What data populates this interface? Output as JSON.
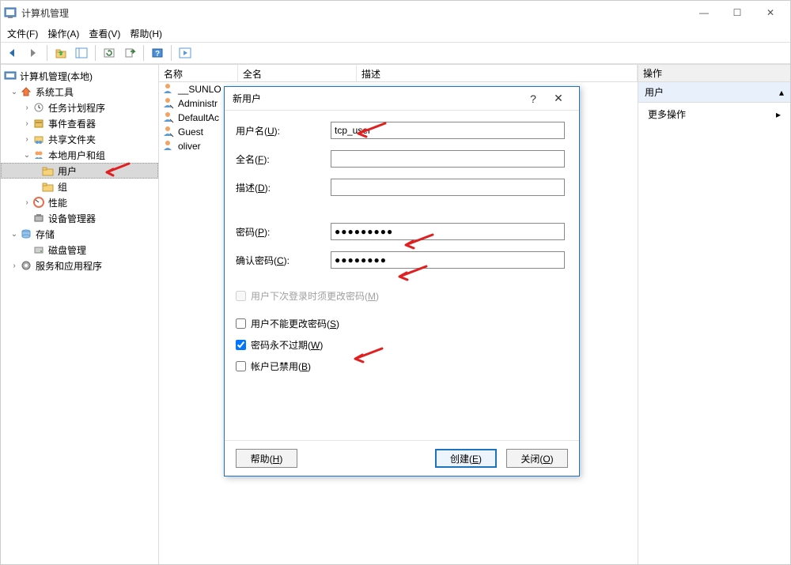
{
  "window": {
    "title": "计算机管理",
    "minimize": "—",
    "maximize": "☐",
    "close": "✕"
  },
  "menubar": {
    "file": "文件(F)",
    "action": "操作(A)",
    "view": "查看(V)",
    "help": "帮助(H)"
  },
  "tree": {
    "root": "计算机管理(本地)",
    "system_tools": "系统工具",
    "task_scheduler": "任务计划程序",
    "event_viewer": "事件查看器",
    "shared_folders": "共享文件夹",
    "local_users": "本地用户和组",
    "users": "用户",
    "groups": "组",
    "performance": "性能",
    "device_manager": "设备管理器",
    "storage": "存储",
    "disk_management": "磁盘管理",
    "services_apps": "服务和应用程序"
  },
  "list": {
    "col_name": "名称",
    "col_fullname": "全名",
    "col_desc": "描述",
    "rows": [
      "__SUNLO",
      "Administr",
      "DefaultAc",
      "Guest",
      "oliver"
    ]
  },
  "actions": {
    "header": "操作",
    "sub": "用户",
    "more": "更多操作"
  },
  "dialog": {
    "title": "新用户",
    "help_q": "?",
    "close_x": "✕",
    "username_label": "用户名(U):",
    "username_value": "tcp_user",
    "fullname_label": "全名(F):",
    "fullname_value": "",
    "desc_label": "描述(D):",
    "desc_value": "",
    "password_label": "密码(P):",
    "password_value": "●●●●●●●●●",
    "confirm_label": "确认密码(C):",
    "confirm_value": "●●●●●●●●",
    "chk_must_change": "用户下次登录时须更改密码(M)",
    "chk_cannot_change": "用户不能更改密码(S)",
    "chk_never_expire": "密码永不过期(W)",
    "chk_disabled": "帐户已禁用(B)",
    "btn_help": "帮助(H)",
    "btn_create": "创建(E)",
    "btn_close": "关闭(O)"
  }
}
